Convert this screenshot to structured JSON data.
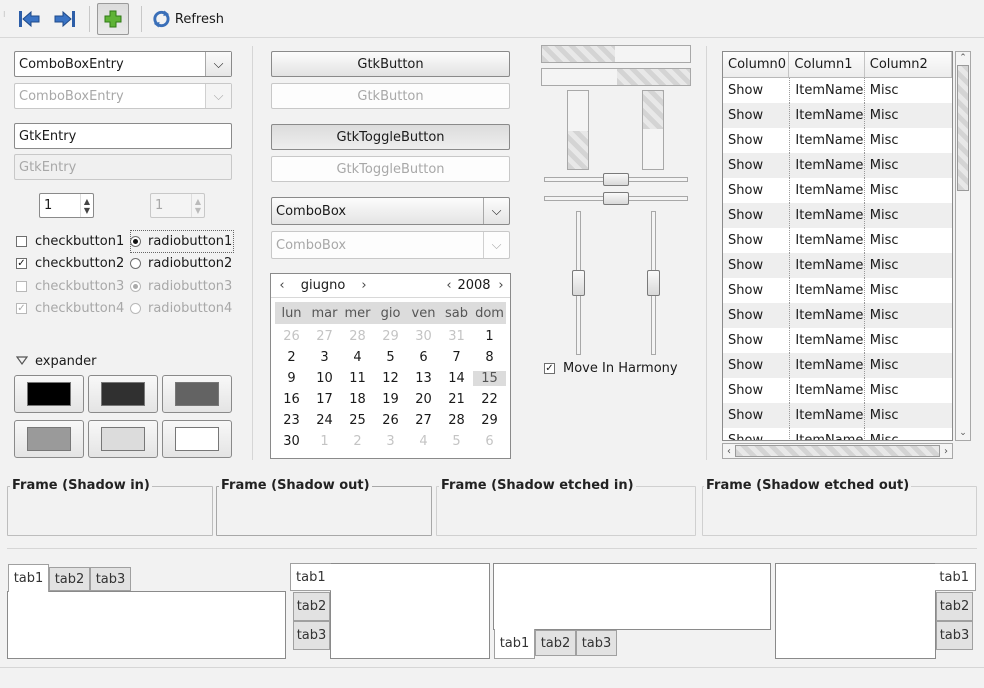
{
  "toolbar": {
    "back_icon": "go-first-icon",
    "forward_icon": "go-last-icon",
    "add_icon": "add-icon",
    "refresh_icon": "refresh-icon",
    "refresh_label": "Refresh"
  },
  "left": {
    "combo_entry": "ComboBoxEntry",
    "combo_entry_disabled": "ComboBoxEntry",
    "entry": "GtkEntry",
    "entry_disabled": "GtkEntry",
    "spin1": "1",
    "spin2": "1",
    "checks": [
      {
        "label": "checkbutton1",
        "checked": false,
        "disabled": false
      },
      {
        "label": "checkbutton2",
        "checked": true,
        "disabled": false
      },
      {
        "label": "checkbutton3",
        "checked": false,
        "disabled": true
      },
      {
        "label": "checkbutton4",
        "checked": true,
        "disabled": true
      }
    ],
    "radios": [
      {
        "label": "radiobutton1",
        "checked": true,
        "disabled": false
      },
      {
        "label": "radiobutton2",
        "checked": false,
        "disabled": false
      },
      {
        "label": "radiobutton3",
        "checked": true,
        "disabled": true
      },
      {
        "label": "radiobutton4",
        "checked": false,
        "disabled": true
      }
    ],
    "expander": "expander",
    "colors": [
      "#000000",
      "#303030",
      "#636363",
      "#9a9a9a",
      "#dcdcdc",
      "#ffffff"
    ]
  },
  "middle": {
    "button": "GtkButton",
    "button_disabled": "GtkButton",
    "toggle": "GtkToggleButton",
    "toggle_disabled": "GtkToggleButton",
    "combo": "ComboBox",
    "combo_disabled": "ComboBox",
    "calendar": {
      "month": "giugno",
      "year": "2008",
      "day_names": [
        "lun",
        "mar",
        "mer",
        "gio",
        "ven",
        "sab",
        "dom"
      ],
      "weeks": [
        [
          "26",
          "27",
          "28",
          "29",
          "30",
          "31",
          "1"
        ],
        [
          "2",
          "3",
          "4",
          "5",
          "6",
          "7",
          "8"
        ],
        [
          "9",
          "10",
          "11",
          "12",
          "13",
          "14",
          "15"
        ],
        [
          "16",
          "17",
          "18",
          "19",
          "20",
          "21",
          "22"
        ],
        [
          "23",
          "24",
          "25",
          "26",
          "27",
          "28",
          "29"
        ],
        [
          "30",
          "1",
          "2",
          "3",
          "4",
          "5",
          "6"
        ]
      ],
      "selected": "15"
    }
  },
  "sliders": {
    "harmony_label": "Move In Harmony",
    "harmony_checked": true
  },
  "tree": {
    "columns": [
      "Column0",
      "Column1",
      "Column2"
    ],
    "rows": [
      [
        "Show",
        "ItemName",
        "Misc"
      ],
      [
        "Show",
        "ItemName",
        "Misc"
      ],
      [
        "Show",
        "ItemName",
        "Misc"
      ],
      [
        "Show",
        "ItemName",
        "Misc"
      ],
      [
        "Show",
        "ItemName",
        "Misc"
      ],
      [
        "Show",
        "ItemName",
        "Misc"
      ],
      [
        "Show",
        "ItemName",
        "Misc"
      ],
      [
        "Show",
        "ItemName",
        "Misc"
      ],
      [
        "Show",
        "ItemName",
        "Misc"
      ],
      [
        "Show",
        "ItemName",
        "Misc"
      ],
      [
        "Show",
        "ItemName",
        "Misc"
      ],
      [
        "Show",
        "ItemName",
        "Misc"
      ],
      [
        "Show",
        "ItemName",
        "Misc"
      ],
      [
        "Show",
        "ItemName",
        "Misc"
      ],
      [
        "Show",
        "ItemName",
        "Misc"
      ]
    ]
  },
  "frames": {
    "in": "Frame (Shadow in)",
    "out": "Frame (Shadow out)",
    "etched_in": "Frame (Shadow etched in)",
    "etched_out": "Frame (Shadow etched out)"
  },
  "tabs": {
    "t1": "tab1",
    "t2": "tab2",
    "t3": "tab3"
  }
}
